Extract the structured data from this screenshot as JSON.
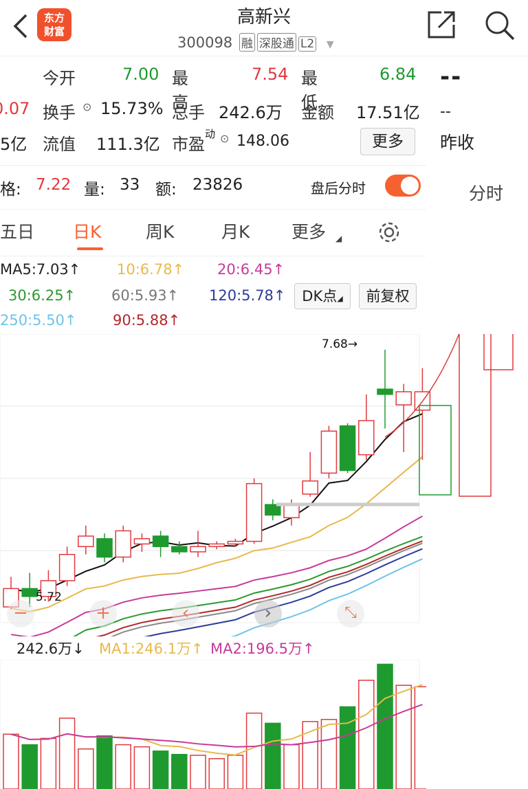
{
  "header": {
    "title": "高新兴",
    "code": "300098",
    "tags": [
      "融",
      "深股通",
      "L2"
    ],
    "logo_lines": [
      "东方",
      "财富"
    ]
  },
  "quote": {
    "open_label": "今开",
    "open": "7.00",
    "high_label": "最高",
    "high": "7.54",
    "low_label": "最低",
    "low": "6.84",
    "left_partial_1": "0.07",
    "turnover_label": "换手",
    "turnover": "15.73%",
    "volume_label": "总手",
    "volume": "242.6万",
    "amount_label": "金额",
    "amount": "17.51亿",
    "left_partial_2": "5亿",
    "float_label": "流值",
    "float_value": "111.3亿",
    "pe_label": "市盈",
    "pe_sup": "动",
    "pe": "148.06",
    "more_label": "更多",
    "right_dash_big": "--",
    "right_dash_small": "--",
    "prev_close_label": "昨收"
  },
  "after_hours": {
    "price_label": "格:",
    "price": "7.22",
    "qty_label": "量:",
    "qty": "33",
    "amt_label": "额:",
    "amt": "23826",
    "toggle_label": "盘后分时"
  },
  "tabs": [
    "五日",
    "日K",
    "周K",
    "月K",
    "更多"
  ],
  "right_tab": "分时",
  "ma": {
    "ma5": "MA5:7.03↑",
    "ma10": "10:6.78↑",
    "ma20": "20:6.45↑",
    "ma30": "30:6.25↑",
    "ma60": "60:5.93↑",
    "ma120": "120:5.78↑",
    "ma250": "250:5.50↑",
    "ma90": "90:5.88↑"
  },
  "buttons": {
    "dk": "DK点",
    "fq": "前复权"
  },
  "chart_labels": {
    "high_mark": "7.68→",
    "low_mark": "5.72"
  },
  "volume_bar": {
    "vol": "242.6万↓",
    "ma1": "MA1:246.1万↑",
    "ma2": "MA2:196.5万↑"
  },
  "colors": {
    "up": "#e0393e",
    "down": "#1f9a2f",
    "accent": "#f5612f"
  },
  "chart_data": {
    "type": "candlestick",
    "candles": [
      {
        "o": 5.72,
        "c": 5.86,
        "h": 5.95,
        "l": 5.7
      },
      {
        "o": 5.86,
        "c": 5.8,
        "h": 5.98,
        "l": 5.72
      },
      {
        "o": 5.8,
        "c": 5.92,
        "h": 6.0,
        "l": 5.76
      },
      {
        "o": 5.92,
        "c": 6.12,
        "h": 6.18,
        "l": 5.88
      },
      {
        "o": 6.18,
        "c": 6.26,
        "h": 6.34,
        "l": 6.12
      },
      {
        "o": 6.24,
        "c": 6.1,
        "h": 6.28,
        "l": 6.06
      },
      {
        "o": 6.1,
        "c": 6.3,
        "h": 6.34,
        "l": 6.06
      },
      {
        "o": 6.2,
        "c": 6.24,
        "h": 6.28,
        "l": 6.14
      },
      {
        "o": 6.26,
        "c": 6.18,
        "h": 6.3,
        "l": 6.1
      },
      {
        "o": 6.18,
        "c": 6.14,
        "h": 6.22,
        "l": 6.12
      },
      {
        "o": 6.14,
        "c": 6.18,
        "h": 6.3,
        "l": 6.1
      },
      {
        "o": 6.18,
        "c": 6.2,
        "h": 6.22,
        "l": 6.16
      },
      {
        "o": 6.2,
        "c": 6.22,
        "h": 6.24,
        "l": 6.18
      },
      {
        "o": 6.22,
        "c": 6.66,
        "h": 6.7,
        "l": 6.2
      },
      {
        "o": 6.5,
        "c": 6.42,
        "h": 6.54,
        "l": 6.38
      },
      {
        "o": 6.4,
        "c": 6.5,
        "h": 6.54,
        "l": 6.34
      },
      {
        "o": 6.58,
        "c": 6.68,
        "h": 6.9,
        "l": 6.56
      },
      {
        "o": 6.74,
        "c": 7.06,
        "h": 7.1,
        "l": 6.7
      },
      {
        "o": 7.1,
        "c": 6.76,
        "h": 7.12,
        "l": 6.74
      },
      {
        "o": 6.88,
        "c": 7.14,
        "h": 7.34,
        "l": 6.84
      },
      {
        "o": 7.38,
        "c": 7.34,
        "h": 7.68,
        "l": 7.08
      },
      {
        "o": 7.26,
        "c": 7.36,
        "h": 7.42,
        "l": 6.9
      },
      {
        "o": 7.22,
        "c": 7.36,
        "h": 7.54,
        "l": 6.84
      }
    ],
    "volumes": [
      1.3,
      1.05,
      1.2,
      1.68,
      0.95,
      1.26,
      1.05,
      1.0,
      0.9,
      0.82,
      0.8,
      0.72,
      0.8,
      1.8,
      1.56,
      1.05,
      1.6,
      1.65,
      1.95,
      2.58,
      2.96,
      2.46,
      2.426
    ],
    "price_range": [
      5.6,
      7.8
    ],
    "volume_range": [
      0,
      3.0
    ]
  }
}
